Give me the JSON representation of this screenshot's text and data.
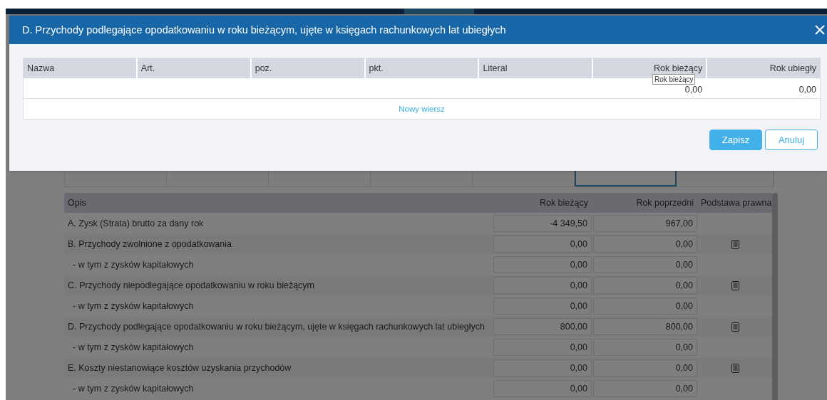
{
  "background": {
    "tabs": [
      {
        "selected": false
      },
      {
        "selected": false
      },
      {
        "selected": false
      },
      {
        "selected": false
      },
      {
        "selected": false
      },
      {
        "selected": true
      },
      {
        "selected": false
      }
    ],
    "table": {
      "columns": [
        "Opis",
        "Rok bieżący",
        "Rok poprzedni",
        "Podstawa prawna"
      ],
      "rows": [
        {
          "kind": "main",
          "label": "A. Zysk (Strata) brutto za dany rok",
          "current": "-4 349,50",
          "previous": "967,00",
          "legal_basis_icon": false
        },
        {
          "kind": "main",
          "label": "B. Przychody zwolnione z opodatkowania",
          "current": "0,00",
          "previous": "0,00",
          "legal_basis_icon": true
        },
        {
          "kind": "sub",
          "label": "- w tym z zysków kapitałowych",
          "current": "0,00",
          "previous": "0,00",
          "legal_basis_icon": false
        },
        {
          "kind": "main",
          "label": "C. Przychody niepodlegające opodatkowaniu w roku bieżącym",
          "current": "0,00",
          "previous": "0,00",
          "legal_basis_icon": true
        },
        {
          "kind": "sub",
          "label": "- w tym z zysków kapitałowych",
          "current": "0,00",
          "previous": "0,00",
          "legal_basis_icon": false
        },
        {
          "kind": "main",
          "label": "D. Przychody podlegające opodatkowaniu w roku bieżącym, ujęte w księgach rachunkowych lat ubiegłych",
          "current": "800,00",
          "previous": "800,00",
          "legal_basis_icon": true
        },
        {
          "kind": "sub",
          "label": "- w tym z zysków kapitałowych",
          "current": "0,00",
          "previous": "0,00",
          "legal_basis_icon": false
        },
        {
          "kind": "main",
          "label": "E. Koszty niestanowiące kosztów uzyskania przychodów",
          "current": "0,00",
          "previous": "0,00",
          "legal_basis_icon": true
        },
        {
          "kind": "sub",
          "label": "- w tym z zysków kapitałowych",
          "current": "0,00",
          "previous": "0,00",
          "legal_basis_icon": false
        }
      ]
    }
  },
  "dialog": {
    "title": "D. Przychody podlegające opodatkowaniu w roku bieżącym, ujęte w księgach rachunkowych lat ubiegłych",
    "columns": [
      "Nazwa",
      "Art.",
      "poz.",
      "pkt.",
      "Literal",
      "Rok bieżący",
      "Rok ubiegły"
    ],
    "rows": [
      {
        "rok_biezacy": "0,00",
        "rok_ubiegly": "0,00"
      }
    ],
    "new_row_link": "Nowy wiersz",
    "tooltip": "Rok bieżący",
    "buttons": [
      {
        "kind": "primary",
        "label": "Zapisz"
      },
      {
        "kind": "secondary",
        "label": "Anuluj"
      }
    ]
  }
}
